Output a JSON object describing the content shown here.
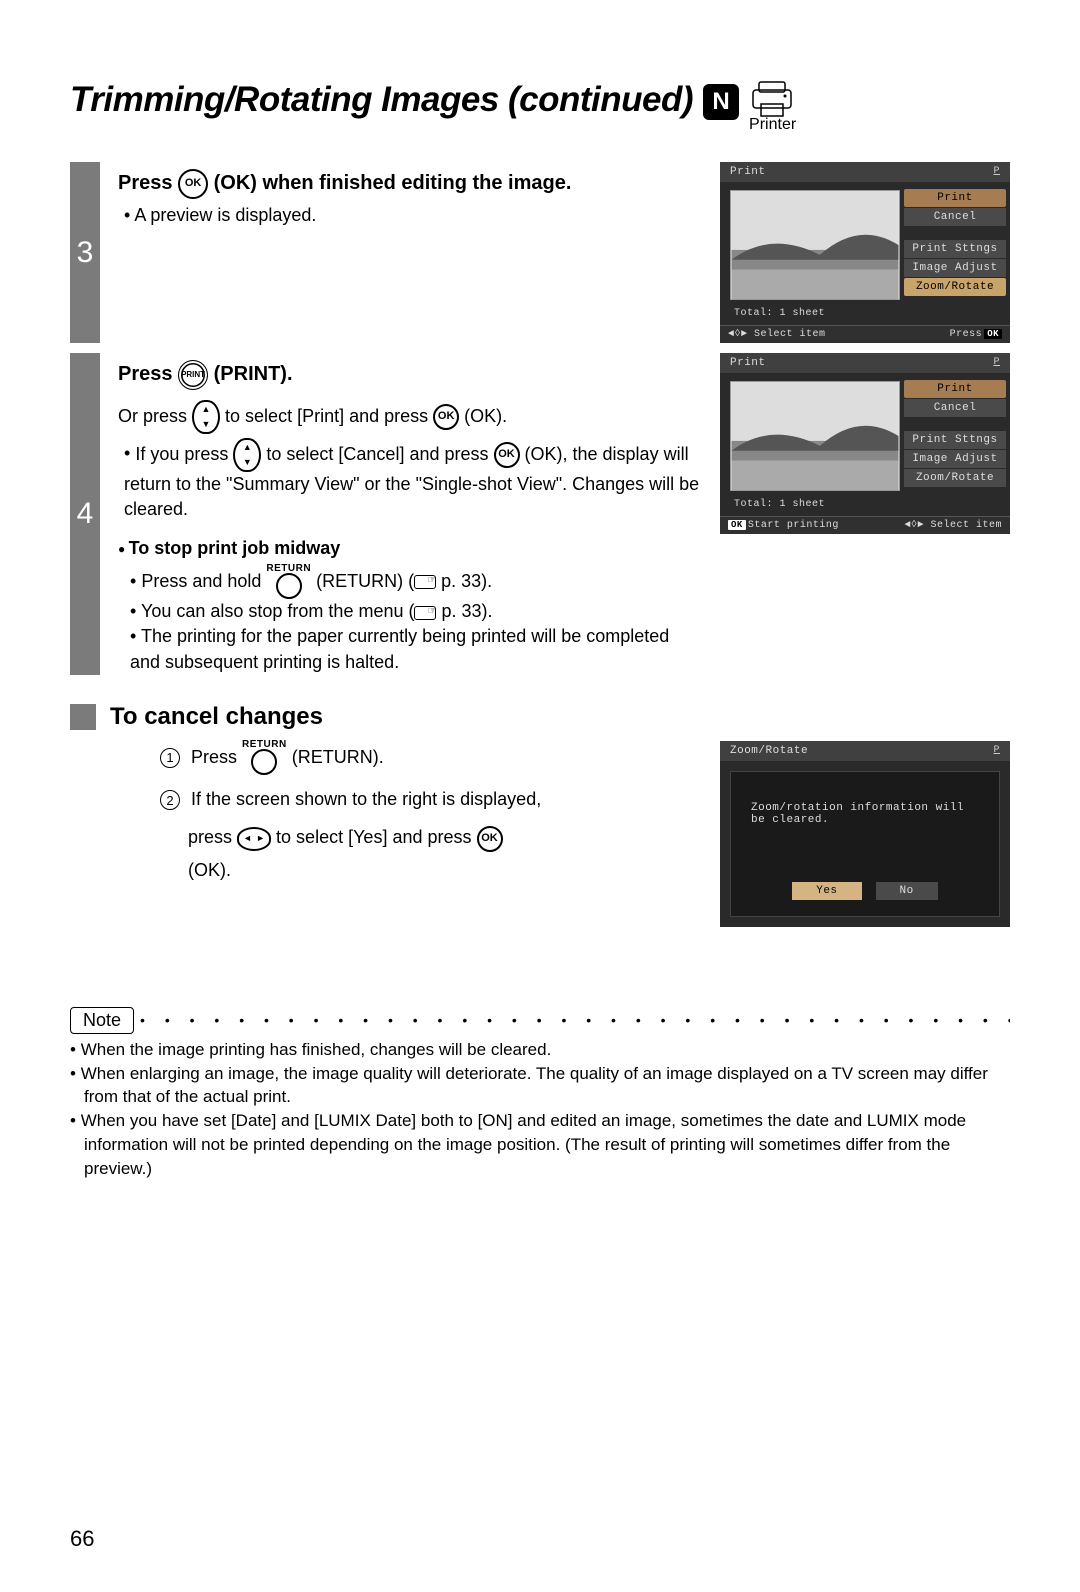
{
  "title": "Trimming/Rotating Images (continued)",
  "nbadge": "N",
  "printer_label": "Printer",
  "step3": {
    "num": "3",
    "head_a": "Press ",
    "ok": "OK",
    "head_b": " (OK) when finished editing the image.",
    "bullet1": "A preview is displayed."
  },
  "step4": {
    "num": "4",
    "head_a": "Press ",
    "print_btn": "PRINT",
    "head_b": " (PRINT).",
    "or_a": "Or press ",
    "or_b": " to select [Print] and press ",
    "or_c": " (OK).",
    "if_a": "If you press ",
    "if_b": " to select [Cancel] and press ",
    "if_c": " (OK), the display will return to the \"Summary View\" or the \"Single-shot View\". Changes will be cleared.",
    "stop_head": "To stop print job midway",
    "return_small": "RETURN",
    "stop_b1_a": "Press and hold ",
    "stop_b1_b": " (RETURN) (",
    "stop_b1_c": " p. 33).",
    "stop_b2_a": "You can also stop from the menu (",
    "stop_b2_b": " p. 33).",
    "stop_b3": "The printing for the paper currently being printed will be completed and subsequent printing is halted."
  },
  "cancel": {
    "title": "To cancel changes",
    "s1_a": "Press ",
    "s1_b": " (RETURN).",
    "s2": "If the screen shown to the right is displayed,",
    "s2b_a": "press ",
    "s2b_b": " to select [Yes] and press ",
    "s2b_c": " (OK)."
  },
  "screen1": {
    "title": "Print",
    "p": "P",
    "m_print": "Print",
    "m_cancel": "Cancel",
    "m_settings": "Print Sttngs",
    "m_adjust": "Image Adjust",
    "m_zoom": "Zoom/Rotate",
    "total": "Total: 1 sheet",
    "foot_l": "◄◊► Select item",
    "foot_r_label": "Press",
    "foot_r_ok": "OK"
  },
  "screen2": {
    "title": "Print",
    "p": "P",
    "m_print": "Print",
    "m_cancel": "Cancel",
    "m_settings": "Print Sttngs",
    "m_adjust": "Image Adjust",
    "m_zoom": "Zoom/Rotate",
    "total": "Total: 1 sheet",
    "foot_l_ok": "OK",
    "foot_l": "Start printing",
    "foot_r": "◄◊► Select item"
  },
  "screen3": {
    "title": "Zoom/Rotate",
    "p": "P",
    "msg": "Zoom/rotation information will be cleared.",
    "yes": "Yes",
    "no": "No"
  },
  "note_label": "Note",
  "dots": "• • • • • • • • • • • • • • • • • • • • • • • • • • • • • • • • • • • • • • • • • • • • • • • • • • •",
  "notes": {
    "n1": "When the image printing has finished, changes will be cleared.",
    "n2": "When enlarging an image, the image quality will deteriorate. The quality of an image displayed on a TV screen may differ from that of the actual print.",
    "n3": "When you have set [Date] and [LUMIX Date] both to [ON] and edited an image, sometimes the date and LUMIX mode information will not be printed depending on the image position. (The result of printing will sometimes differ from the preview.)"
  },
  "pagenum": "66"
}
